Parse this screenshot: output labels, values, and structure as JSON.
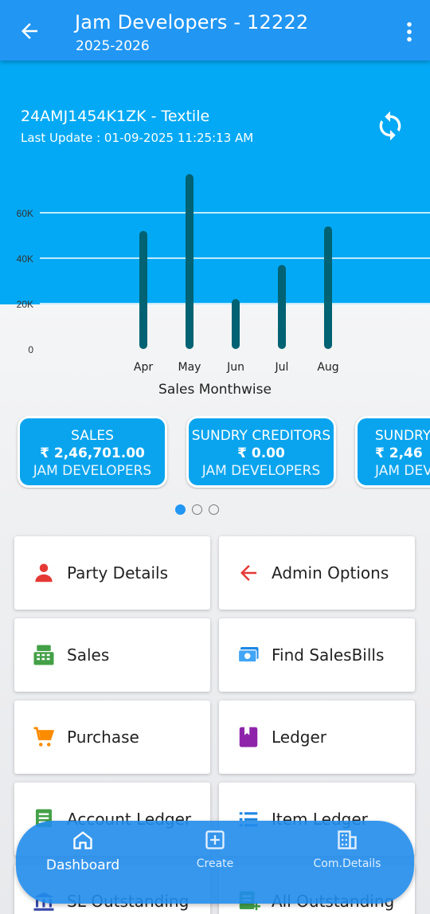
{
  "appbar": {
    "title": "Jam Developers - 12222",
    "subtitle": "2025-2026"
  },
  "hero": {
    "firm_line": "24AMJ1454K1ZK - Textile",
    "last_update": "Last Update : 01-09-2025 11:25:13 AM"
  },
  "chart_data": {
    "type": "bar",
    "categories": [
      "Apr",
      "May",
      "Jun",
      "Jul",
      "Aug"
    ],
    "values": [
      52000,
      77000,
      22000,
      37000,
      54000
    ],
    "title": "",
    "xlabel": "Sales Monthwise",
    "ylabel": "",
    "ylim": [
      0,
      80000
    ],
    "y_ticks": [
      "0",
      "20K",
      "40K",
      "60K"
    ],
    "grid": true,
    "bar_color": "#006272"
  },
  "cards": [
    {
      "title": "SALES",
      "amount": "₹ 2,46,701.00",
      "name": "JAM DEVELOPERS"
    },
    {
      "title": "SUNDRY CREDITORS",
      "amount": "₹ 0.00",
      "name": "JAM DEVELOPERS"
    },
    {
      "title": "SUNDRY",
      "amount": "₹ 2,46",
      "name": "JAM DEV"
    }
  ],
  "menu": [
    {
      "label": "Party Details",
      "icon": "person-icon"
    },
    {
      "label": "Admin Options",
      "icon": "arrow-left-icon"
    },
    {
      "label": "Sales",
      "icon": "cash-register-icon"
    },
    {
      "label": "Find SalesBills",
      "icon": "money-icon"
    },
    {
      "label": "Purchase",
      "icon": "cart-icon"
    },
    {
      "label": "Ledger",
      "icon": "book-icon"
    },
    {
      "label": "Account Ledger",
      "icon": "list-doc-icon"
    },
    {
      "label": "Item Ledger",
      "icon": "list-icon"
    },
    {
      "label": "SL Outstanding",
      "icon": "bank-icon"
    },
    {
      "label": "All Outstanding",
      "icon": "doc-add-icon"
    }
  ],
  "bottom_nav": {
    "dashboard": "Dashboard",
    "create": "Create",
    "company": "Com.Details"
  },
  "colors": {
    "appbar": "#2196f3",
    "hero": "#03a9f4",
    "accent": "#2196f3"
  }
}
